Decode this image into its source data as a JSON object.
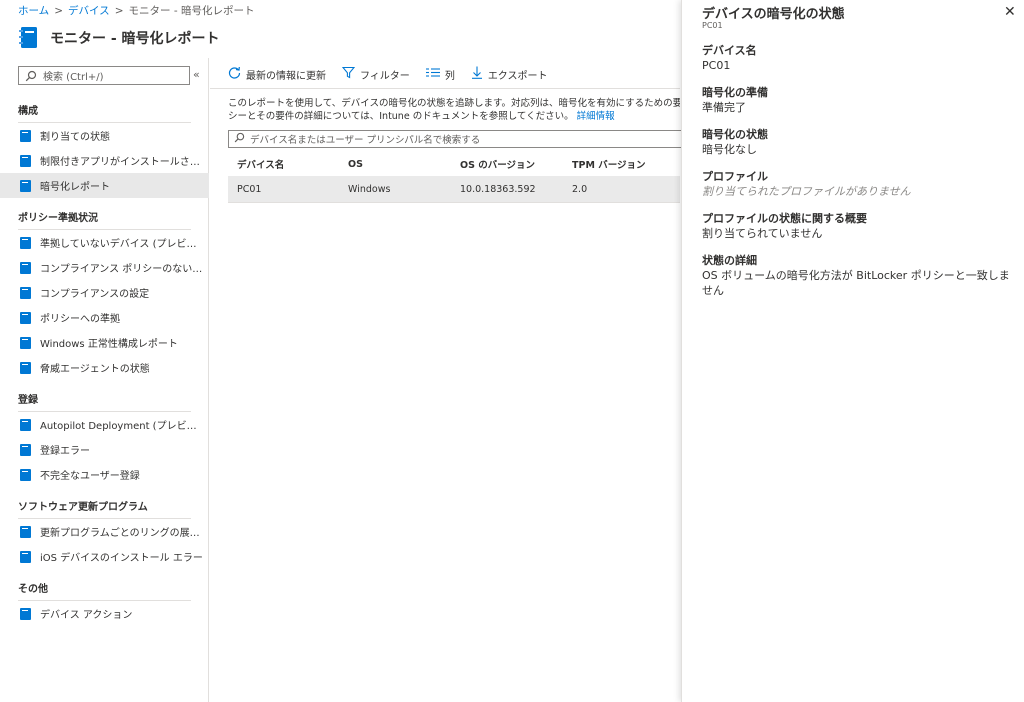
{
  "breadcrumb": {
    "items": [
      "ホーム",
      "デバイス",
      "モニター - 暗号化レポート"
    ]
  },
  "page": {
    "title": "モニター - 暗号化レポート"
  },
  "sidebar": {
    "search_placeholder": "検索 (Ctrl+/)",
    "collapse_label": "«",
    "sections": [
      {
        "header": "構成",
        "items": [
          {
            "label": "割り当ての状態"
          },
          {
            "label": "制限付きアプリがインストールされた..."
          },
          {
            "label": "暗号化レポート",
            "selected": true
          }
        ]
      },
      {
        "header": "ポリシー準拠状況",
        "items": [
          {
            "label": "準拠していないデバイス (プレビュー)"
          },
          {
            "label": "コンプライアンス ポリシーのないデバイ..."
          },
          {
            "label": "コンプライアンスの設定"
          },
          {
            "label": "ポリシーへの準拠"
          },
          {
            "label": "Windows 正常性構成レポート"
          },
          {
            "label": "脅威エージェントの状態"
          }
        ]
      },
      {
        "header": "登録",
        "items": [
          {
            "label": "Autopilot Deployment (プレビュー)"
          },
          {
            "label": "登録エラー"
          },
          {
            "label": "不完全なユーザー登録"
          }
        ]
      },
      {
        "header": "ソフトウェア更新プログラム",
        "items": [
          {
            "label": "更新プログラムごとのリングの展開の..."
          },
          {
            "label": "iOS デバイスのインストール エラー"
          }
        ]
      },
      {
        "header": "その他",
        "items": [
          {
            "label": "デバイス アクション"
          }
        ]
      }
    ]
  },
  "toolbar": {
    "refresh_label": "最新の情報に更新",
    "filter_label": "フィルター",
    "columns_label": "列",
    "export_label": "エクスポート"
  },
  "main": {
    "description_line1": "このレポートを使用して、デバイスの暗号化の状態を追跡します。対応列は、暗号化を有効にするための要件をデバ",
    "description_line2": "シーとその要件の詳細については、Intune のドキュメントを参照してください。",
    "learn_more": "詳細情報",
    "search_placeholder": "デバイス名またはユーザー プリンシパル名で検索する"
  },
  "table": {
    "columns": [
      "デバイス名",
      "OS",
      "OS のバージョン",
      "TPM バージョン"
    ],
    "rows": [
      [
        "PC01",
        "Windows",
        "10.0.18363.592",
        "2.0"
      ]
    ]
  },
  "blade": {
    "title": "デバイスの暗号化の状態",
    "subtitle": "PC01",
    "close_label": "✕",
    "fields": [
      {
        "label": "デバイス名",
        "value": "PC01"
      },
      {
        "label": "暗号化の準備",
        "value": "準備完了"
      },
      {
        "label": "暗号化の状態",
        "value": "暗号化なし"
      },
      {
        "label": "プロファイル",
        "value": "割り当てられたプロファイルがありません",
        "muted": true
      },
      {
        "label": "プロファイルの状態に関する概要",
        "value": "割り当てられていません"
      },
      {
        "label": "状態の詳細",
        "value": "OS ボリュームの暗号化方法が BitLocker ポリシーと一致しま\nせん"
      }
    ]
  },
  "colors": {
    "accent": "#0078d4",
    "selected_bg": "#e8e8e8",
    "row_bg": "#eaeaea"
  }
}
